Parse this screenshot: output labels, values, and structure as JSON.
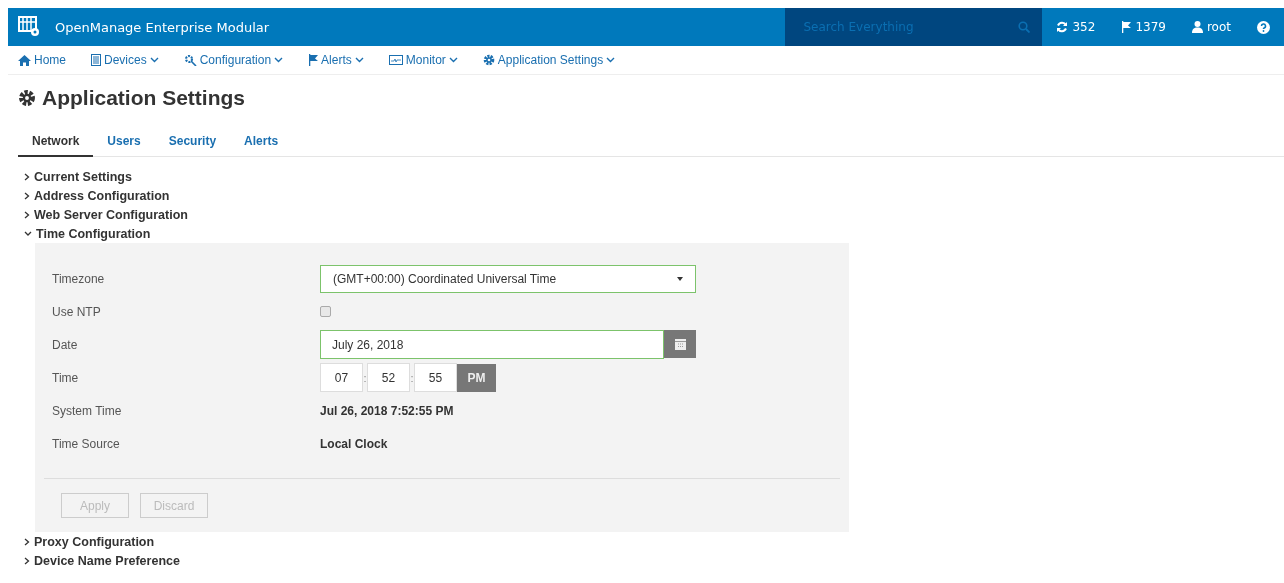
{
  "app": {
    "title": "OpenManage Enterprise Modular"
  },
  "search": {
    "placeholder": "Search Everything"
  },
  "header_items": [
    {
      "kind": "jobs",
      "label": "352"
    },
    {
      "kind": "alerts",
      "label": "1379"
    },
    {
      "kind": "user",
      "label": "root"
    },
    {
      "kind": "help"
    }
  ],
  "nav": [
    {
      "kind": "home",
      "label": "Home",
      "dropdown": false
    },
    {
      "kind": "devices",
      "label": "Devices",
      "dropdown": true
    },
    {
      "kind": "configuration",
      "label": "Configuration",
      "dropdown": true
    },
    {
      "kind": "alerts",
      "label": "Alerts",
      "dropdown": true
    },
    {
      "kind": "monitor",
      "label": "Monitor",
      "dropdown": true
    },
    {
      "kind": "settings",
      "label": "Application Settings",
      "dropdown": true
    }
  ],
  "page_title": "Application Settings",
  "tabs": [
    {
      "label": "Network",
      "selected": true
    },
    {
      "label": "Users",
      "selected": false
    },
    {
      "label": "Security",
      "selected": false
    },
    {
      "label": "Alerts",
      "selected": false
    }
  ],
  "sections": [
    {
      "label": "Current Settings",
      "expanded": false
    },
    {
      "label": "Address Configuration",
      "expanded": false
    },
    {
      "label": "Web Server Configuration",
      "expanded": false
    },
    {
      "label": "Time Configuration",
      "expanded": true,
      "fields": [
        {
          "kind": "select",
          "label": "Timezone",
          "value": "(GMT+00:00) Coordinated Universal Time"
        },
        {
          "kind": "checkbox",
          "label": "Use NTP",
          "checked": false
        },
        {
          "kind": "date",
          "label": "Date",
          "value": "July 26, 2018"
        },
        {
          "kind": "time",
          "label": "Time",
          "hour": "07",
          "separator": ":",
          "minute": "52",
          "second": "55",
          "ampm": "PM"
        },
        {
          "kind": "text",
          "label": "System Time",
          "value": "Jul 26, 2018 7:52:55 PM"
        },
        {
          "kind": "text",
          "label": "Time Source",
          "value": "Local Clock"
        }
      ],
      "buttons": [
        {
          "label": "Apply",
          "disabled": true
        },
        {
          "label": "Discard",
          "disabled": true
        }
      ]
    },
    {
      "label": "Proxy Configuration",
      "expanded": false
    },
    {
      "label": "Device Name Preference",
      "expanded": false
    }
  ]
}
